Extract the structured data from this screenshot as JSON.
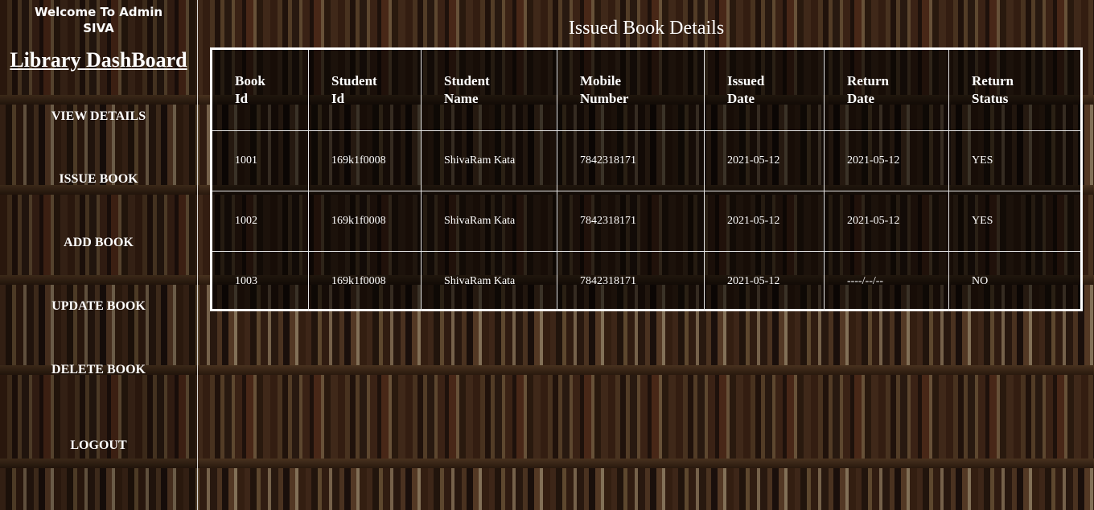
{
  "sidebar": {
    "welcome_line1": "Welcome To Admin",
    "welcome_line2": "SIVA",
    "title": "Library DashBoard",
    "nav": {
      "view_details": "VIEW DETAILS",
      "issue_book": "ISSUE BOOK",
      "add_book": "ADD BOOK",
      "update_book": "UPDATE BOOK",
      "delete_book": "DELETE BOOK",
      "logout": "LOGOUT"
    }
  },
  "main": {
    "title": "Issued Book Details",
    "columns": [
      [
        "Book",
        "Id"
      ],
      [
        "Student",
        "Id"
      ],
      [
        "Student",
        "Name"
      ],
      [
        "Mobile",
        "Number"
      ],
      [
        "Issued",
        "Date"
      ],
      [
        "Return",
        "Date"
      ],
      [
        "Return",
        "Status"
      ]
    ],
    "rows": [
      [
        "1001",
        "169k1f0008",
        "ShivaRam Kata",
        "7842318171",
        "2021-05-12",
        "2021-05-12",
        "YES"
      ],
      [
        "1002",
        "169k1f0008",
        "ShivaRam Kata",
        "7842318171",
        "2021-05-12",
        "2021-05-12",
        "YES"
      ],
      [
        "1003",
        "169k1f0008",
        "ShivaRam Kata",
        "7842318171",
        "2021-05-12",
        "----/--/--",
        "NO"
      ]
    ]
  }
}
